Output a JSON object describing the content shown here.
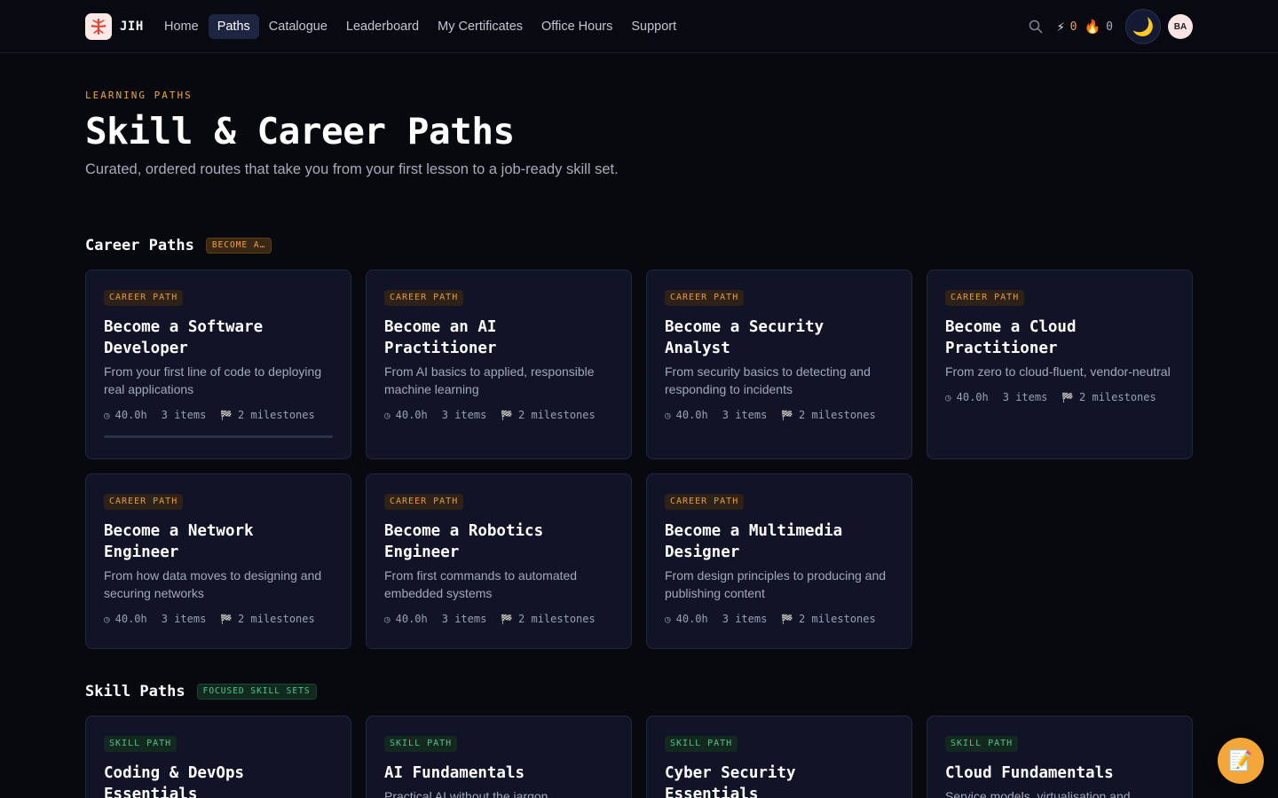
{
  "brand": {
    "name": "JIH",
    "logo_icon": "brand-logo-icon"
  },
  "nav": {
    "items": [
      "Home",
      "Paths",
      "Catalogue",
      "Leaderboard",
      "My Certificates",
      "Office Hours",
      "Support"
    ],
    "active": "Paths"
  },
  "toolbar": {
    "xp_icon": "⚡",
    "xp_value": "0",
    "streak_icon": "🔥",
    "streak_value": "0",
    "theme_icon": "🌙",
    "avatar_initials": "BA"
  },
  "hero": {
    "eyebrow": "LEARNING PATHS",
    "title": "Skill & Career Paths",
    "subtitle": "Curated, ordered routes that take you from your first lesson to a job-ready skill set."
  },
  "sections": {
    "career": {
      "title": "Career Paths",
      "badge": "BECOME A…"
    },
    "skill": {
      "title": "Skill Paths",
      "badge": "FOCUSED SKILL SETS"
    }
  },
  "career_cards": [
    {
      "tag": "CAREER PATH",
      "title": "Become a Software Developer",
      "desc": "From your first line of code to deploying real applications",
      "hours": "40.0h",
      "items": "3 items",
      "milestones": "2 milestones",
      "progress": 0
    },
    {
      "tag": "CAREER PATH",
      "title": "Become an AI Practitioner",
      "desc": "From AI basics to applied, responsible machine learning",
      "hours": "40.0h",
      "items": "3 items",
      "milestones": "2 milestones"
    },
    {
      "tag": "CAREER PATH",
      "title": "Become a Security Analyst",
      "desc": "From security basics to detecting and responding to incidents",
      "hours": "40.0h",
      "items": "3 items",
      "milestones": "2 milestones"
    },
    {
      "tag": "CAREER PATH",
      "title": "Become a Cloud Practitioner",
      "desc": "From zero to cloud-fluent, vendor-neutral",
      "hours": "40.0h",
      "items": "3 items",
      "milestones": "2 milestones"
    },
    {
      "tag": "CAREER PATH",
      "title": "Become a Network Engineer",
      "desc": "From how data moves to designing and securing networks",
      "hours": "40.0h",
      "items": "3 items",
      "milestones": "2 milestones"
    },
    {
      "tag": "CAREER PATH",
      "title": "Become a Robotics Engineer",
      "desc": "From first commands to automated embedded systems",
      "hours": "40.0h",
      "items": "3 items",
      "milestones": "2 milestones"
    },
    {
      "tag": "CAREER PATH",
      "title": "Become a Multimedia Designer",
      "desc": "From design principles to producing and publishing content",
      "hours": "40.0h",
      "items": "3 items",
      "milestones": "2 milestones"
    }
  ],
  "skill_cards": [
    {
      "tag": "SKILL PATH",
      "title": "Coding & DevOps Essentials",
      "desc": ""
    },
    {
      "tag": "SKILL PATH",
      "title": "AI Fundamentals",
      "desc": "Practical AI without the jargon"
    },
    {
      "tag": "SKILL PATH",
      "title": "Cyber Security Essentials",
      "desc": ""
    },
    {
      "tag": "SKILL PATH",
      "title": "Cloud Fundamentals",
      "desc": "Service models, virtualisation and"
    }
  ],
  "meta_icons": {
    "hours": "◷",
    "milestones": "🏁"
  },
  "fab_icon": "📝"
}
